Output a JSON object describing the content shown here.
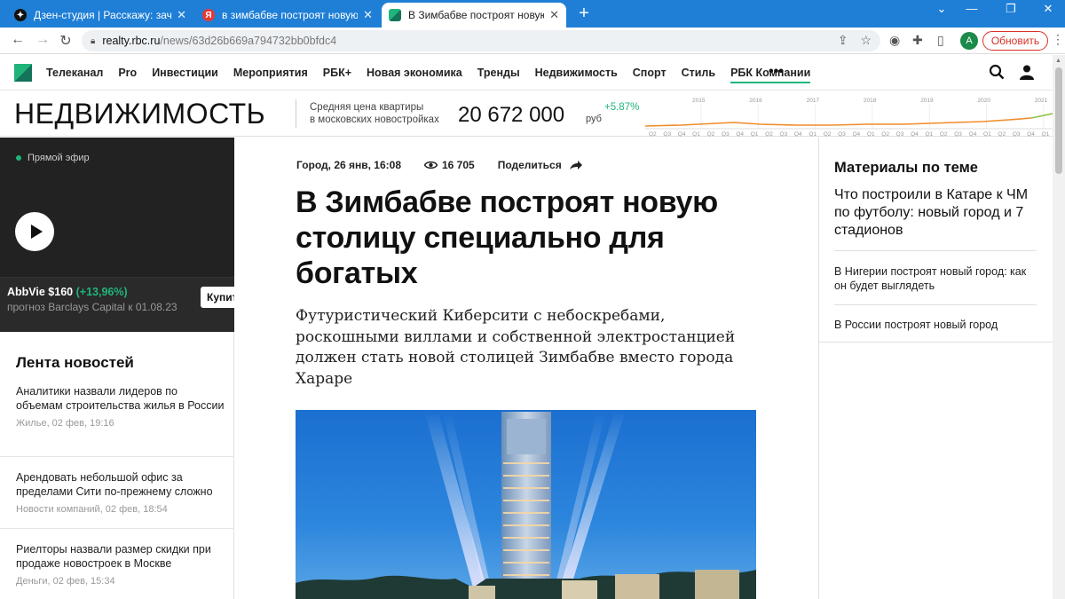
{
  "browser": {
    "tabs": [
      {
        "title": "Дзен-студия | Расскажу: зачем /",
        "icon": "zen-icon"
      },
      {
        "title": "в зимбабве построят новую сто",
        "icon": "yandex-icon",
        "icon_glyph": "Я"
      },
      {
        "title": "В Зимбабве построят новую сто",
        "icon": "rbc-icon",
        "active": true
      }
    ],
    "url_host": "realty.rbc.ru",
    "url_path": "/news/63d26b669a794732bb0bfdc4",
    "profile_initial": "A",
    "update_label": "Обновить"
  },
  "site_nav": {
    "items": [
      "Телеканал",
      "Pro",
      "Инвестиции",
      "Мероприятия",
      "РБК+",
      "Новая экономика",
      "Тренды",
      "Недвижимость",
      "Спорт",
      "Стиль",
      "РБК Компании"
    ],
    "more": "•••"
  },
  "rubric": {
    "title": "НЕДВИЖИМОСТЬ",
    "price_label_1": "Средняя цена квартиры",
    "price_label_2": "в московских новостройках",
    "price_value": "20 672 000",
    "price_unit": "руб",
    "price_change": "+5.87%",
    "chart": {
      "years": [
        "2015",
        "2016",
        "2017",
        "2018",
        "2019",
        "2020",
        "2021"
      ],
      "quarters": [
        "Q2",
        "Q3",
        "Q4",
        "Q1",
        "Q2",
        "Q3",
        "Q4",
        "Q1",
        "Q2",
        "Q3",
        "Q4",
        "Q1",
        "Q2",
        "Q3",
        "Q4",
        "Q1",
        "Q2",
        "Q3",
        "Q4",
        "Q1",
        "Q2",
        "Q3",
        "Q4",
        "Q1",
        "Q2",
        "Q3",
        "Q4",
        "Q1"
      ],
      "line_color": "#f08c2a",
      "end_color": "#8bc34a"
    }
  },
  "live": {
    "label": "Прямой эфир",
    "stock_name": "AbbVie $160",
    "stock_change": "(+13,96%)",
    "stock_note": "прогноз Barclays Capital к 01.08.23",
    "buy_label": "Купить"
  },
  "feed": {
    "title": "Лента новостей",
    "items": [
      {
        "title": "Аналитики назвали лидеров по объемам строительства жилья в России",
        "meta": "Жилье, 02 фев, 19:16"
      },
      {
        "title": "Арендовать небольшой офис за пределами Сити по-прежнему сложно",
        "meta": "Новости компаний, 02 фев, 18:54"
      },
      {
        "title": "Риелторы назвали размер скидки при продаже новостроек в Москве",
        "meta": "Деньги, 02 фев, 15:34"
      }
    ]
  },
  "article": {
    "meta_date": "Город, 26 янв, 16:08",
    "views": "16 705",
    "share_label": "Поделиться",
    "headline": "В Зимбабве построят новую столицу специально для богатых",
    "lead": "Футуристический Киберсити с небоскребами, роскошными виллами и собственной электростанцией должен стать новой столицей Зимбабве вместо города Хараре"
  },
  "related": {
    "title": "Материалы по теме",
    "items": [
      "Что построили в Катаре к ЧМ по футболу: новый город и 7 стадионов",
      "В Нигерии построят новый город: как он будет выглядеть",
      "В России построят новый город"
    ]
  }
}
